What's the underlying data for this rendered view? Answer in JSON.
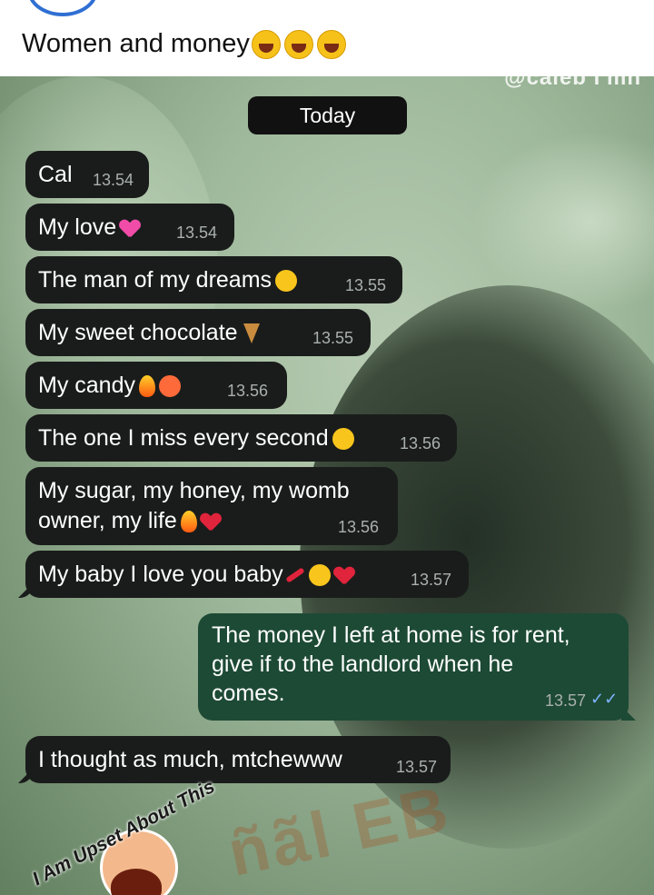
{
  "post": {
    "caption": "Women and money"
  },
  "chat": {
    "watermark_top": "@caleb I'mh",
    "day_label": "Today",
    "messages": [
      {
        "text": "Cal",
        "time": "13.54"
      },
      {
        "text": "My love",
        "time": "13.54"
      },
      {
        "text": "The man of my dreams",
        "time": "13.55"
      },
      {
        "text": "My sweet chocolate",
        "time": "13.55"
      },
      {
        "text": "My candy",
        "time": "13.56"
      },
      {
        "text": "The one I miss every second",
        "time": "13.56"
      },
      {
        "line1": "My sugar, my honey, my womb",
        "line2": "owner, my life",
        "time": "13.56"
      },
      {
        "text": "My baby I love you baby",
        "time": "13.57"
      }
    ],
    "outgoing": {
      "line1": "The money I left at home is for rent,",
      "line2": "give if to the landlord when he",
      "line3": "comes.",
      "time": "13.57",
      "ticks": "✓✓"
    },
    "reply": {
      "text": "I thought as much, mtchewww",
      "time": "13.57"
    }
  },
  "sticker": {
    "text": "I Am Upset About This"
  },
  "watermark": "ñãl EB"
}
